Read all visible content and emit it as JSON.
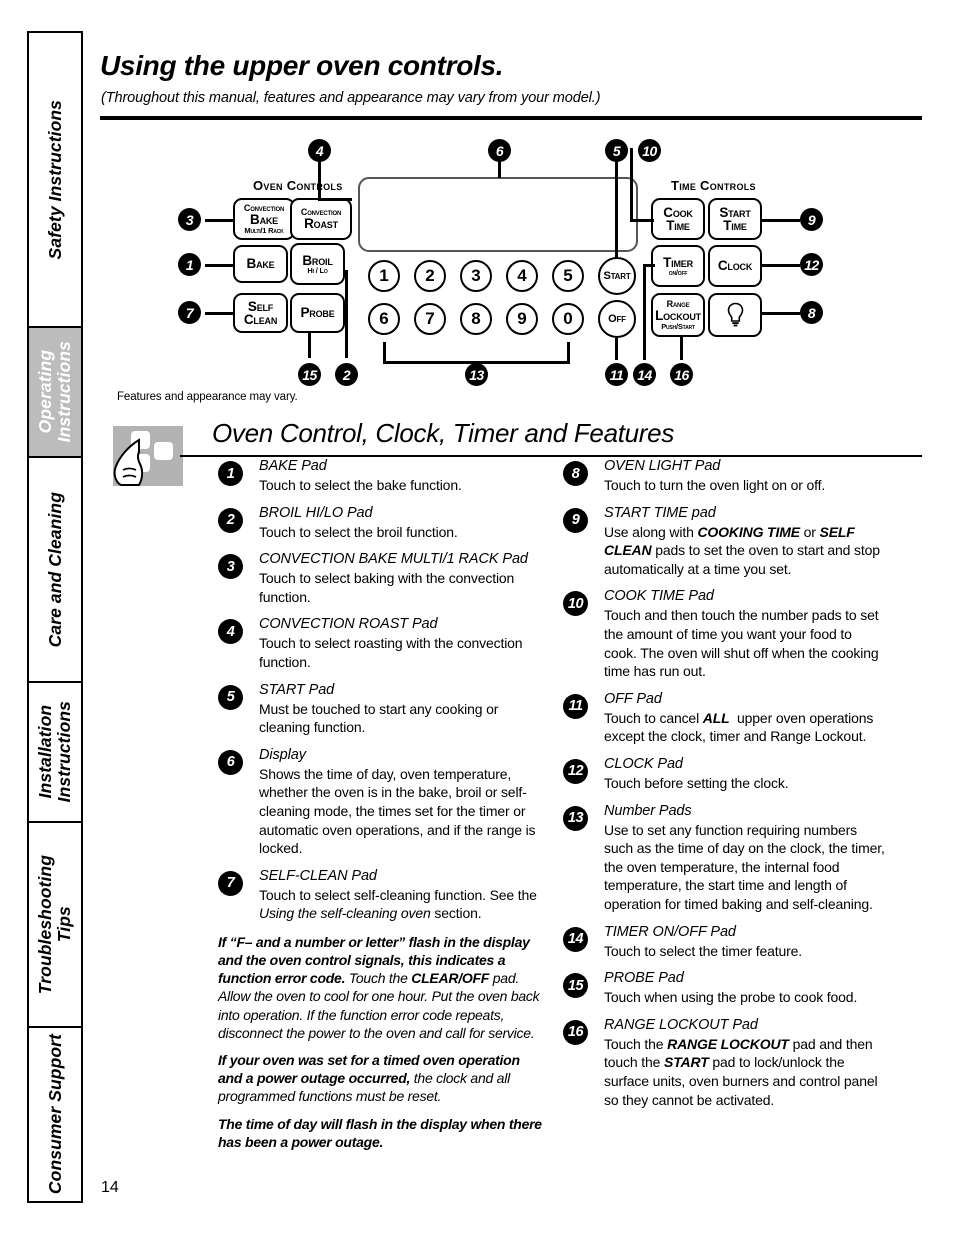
{
  "sidebar": {
    "tabs": [
      {
        "label": "Safety Instructions",
        "active": false
      },
      {
        "label": "Operating\nInstructions",
        "active": true
      },
      {
        "label": "Care and Cleaning",
        "active": false
      },
      {
        "label": "Installation\nInstructions",
        "active": false
      },
      {
        "label": "Troubleshooting\nTips",
        "active": false
      },
      {
        "label": "Consumer Support",
        "active": false
      }
    ]
  },
  "header": {
    "title": "Using the upper oven controls.",
    "subtitle": "(Throughout this manual, features and appearance may vary from your model.)"
  },
  "panel": {
    "oven_controls_title": "Oven Controls",
    "time_controls_title": "Time Controls",
    "caption": "Features and appearance may vary.",
    "pads": {
      "convection_bake": {
        "l1": "Convection",
        "l2": "Bake",
        "l3": "Multi/1 Rack"
      },
      "convection_roast": {
        "l1": "Convection",
        "l2": "Roast"
      },
      "bake": {
        "l2": "Bake"
      },
      "broil": {
        "l2": "Broil",
        "l3": "Hi / Lo"
      },
      "self_clean": {
        "l1": "Self",
        "l2": "Clean"
      },
      "probe": {
        "l2": "Probe"
      },
      "cook_time": {
        "l1": "Cook",
        "l2": "Time"
      },
      "start_time": {
        "l1": "Start",
        "l2": "Time"
      },
      "timer": {
        "l1": "Timer",
        "l2": "on/off"
      },
      "clock": {
        "l2": "Clock"
      },
      "range_lockout": {
        "l1": "Range",
        "l2": "Lockout",
        "l3": "Push/Start"
      },
      "oven_light": {
        "icon": "lightbulb-icon"
      },
      "start": {
        "label": "Start"
      },
      "off": {
        "label": "Off"
      }
    },
    "number_pads": [
      "1",
      "2",
      "3",
      "4",
      "5",
      "6",
      "7",
      "8",
      "9",
      "0"
    ],
    "callouts": [
      "1",
      "2",
      "3",
      "4",
      "5",
      "6",
      "7",
      "8",
      "9",
      "10",
      "11",
      "12",
      "13",
      "14",
      "15",
      "16"
    ]
  },
  "section": {
    "heading": "Oven Control, Clock, Timer and Features"
  },
  "items": [
    {
      "n": "1",
      "term": "BAKE Pad",
      "desc": "Touch to select the bake function."
    },
    {
      "n": "2",
      "term": "BROIL HI/LO Pad",
      "desc": "Touch to select the broil function."
    },
    {
      "n": "3",
      "term": "CONVECTION BAKE MULTI/1 RACK Pad",
      "desc": "Touch to select baking with the convection function."
    },
    {
      "n": "4",
      "term": "CONVECTION ROAST Pad",
      "desc": "Touch to select roasting with the convection function."
    },
    {
      "n": "5",
      "term": "START Pad",
      "desc": "Must be touched to start any cooking or cleaning function."
    },
    {
      "n": "6",
      "term": "Display",
      "desc": "Shows the time of day, oven temperature, whether the oven is in the bake, broil or self-cleaning mode, the times set for the timer or automatic oven operations, and if the range is locked."
    },
    {
      "n": "7",
      "term": "SELF-CLEAN Pad",
      "desc_html": "Touch to select self-cleaning function. See the <i>Using the self-cleaning oven</i> section."
    },
    {
      "n": "8",
      "term": "OVEN LIGHT Pad",
      "desc": "Touch to turn the oven light on or off."
    },
    {
      "n": "9",
      "term": "START TIME pad",
      "desc_html": "Use along with <b>COOKING TIME</b> or <b>SELF CLEAN</b> pads to set the oven to start and stop automatically at a time you set."
    },
    {
      "n": "10",
      "term": "COOK TIME Pad",
      "desc": "Touch and then touch the number pads to set the amount of time you want your food to cook. The oven will shut off when the cooking time has run out."
    },
    {
      "n": "11",
      "term": "OFF Pad",
      "desc_html": "Touch to cancel <b>ALL</b>&nbsp; upper oven operations except the clock, timer and Range Lockout."
    },
    {
      "n": "12",
      "term": "CLOCK Pad",
      "desc": "Touch before setting the clock."
    },
    {
      "n": "13",
      "term": "Number Pads",
      "desc": "Use to set any function requiring numbers such as the time of day on the clock, the timer, the oven temperature, the internal food temperature, the start time and length of operation for timed baking and self-cleaning."
    },
    {
      "n": "14",
      "term": "TIMER ON/OFF Pad",
      "desc": "Touch to select the timer feature."
    },
    {
      "n": "15",
      "term": "PROBE Pad",
      "desc": "Touch when using the probe to cook food."
    },
    {
      "n": "16",
      "term": "RANGE LOCKOUT Pad",
      "desc_html": "Touch the <b>RANGE LOCKOUT</b> pad and then touch the <b>START</b> pad to lock/unlock the surface units, oven burners and control panel so they cannot be activated."
    }
  ],
  "notes": [
    "<b>If “F– and a number or letter” flash in the display and the oven control signals, this indicates a function error code.</b> Touch the <b>CLEAR/OFF</b> pad. Allow the oven to cool for one hour. Put the oven back into operation. If the function error code repeats, disconnect the power to the oven and call for service.",
    "<b>If your oven was set for a timed oven operation and a power outage occurred,</b> the clock and all programmed functions must be reset.",
    "<b>The time of day will flash in the display when there has been a power outage.</b>"
  ],
  "footer": {
    "page_number": "14"
  }
}
